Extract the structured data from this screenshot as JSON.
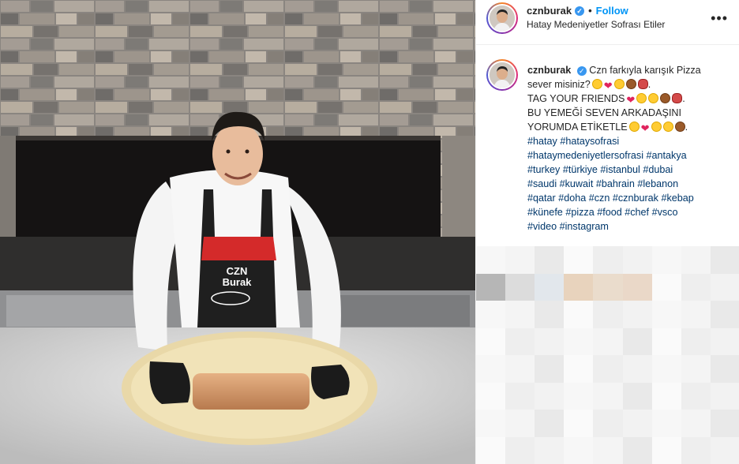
{
  "post": {
    "username": "cznburak",
    "follow_label": "Follow",
    "separator": "•",
    "location": "Hatay Medeniyetler Sofrası Etiler",
    "more_icon": "more-horizontal-icon",
    "verified_icon": "verified-badge-icon",
    "apron_brand_top": "CZN",
    "apron_brand_bottom": "Burak",
    "caption": {
      "username": "cznburak",
      "line1": "Czn farkıyla karışık Pizza",
      "line2": "sever misiniz?",
      "line3": "TAG YOUR FRIENDS",
      "line4": "BU YEMEĞİ SEVEN ARKADAŞINI",
      "line5": "YORUMDA ETİKETLE",
      "hashtags": [
        [
          "#hatay",
          "#hataysofrasi"
        ],
        [
          "#hataymedeniyetlersofrasi",
          "#antakya"
        ],
        [
          "#turkey",
          "#türkiye",
          "#istanbul",
          "#dubai"
        ],
        [
          "#saudi",
          "#kuwait",
          "#bahrain",
          "#lebanon"
        ],
        [
          "#qatar",
          "#doha",
          "#czn",
          "#cznburak",
          "#kebap"
        ],
        [
          "#künefe",
          "#pizza",
          "#food",
          "#chef",
          "#vsco"
        ],
        [
          "#video",
          "#instagram"
        ]
      ]
    }
  },
  "colors": {
    "link_blue": "#0095f6",
    "hashtag": "#00376b",
    "verified": "#3897f0",
    "apron_red": "#d42a2a"
  }
}
